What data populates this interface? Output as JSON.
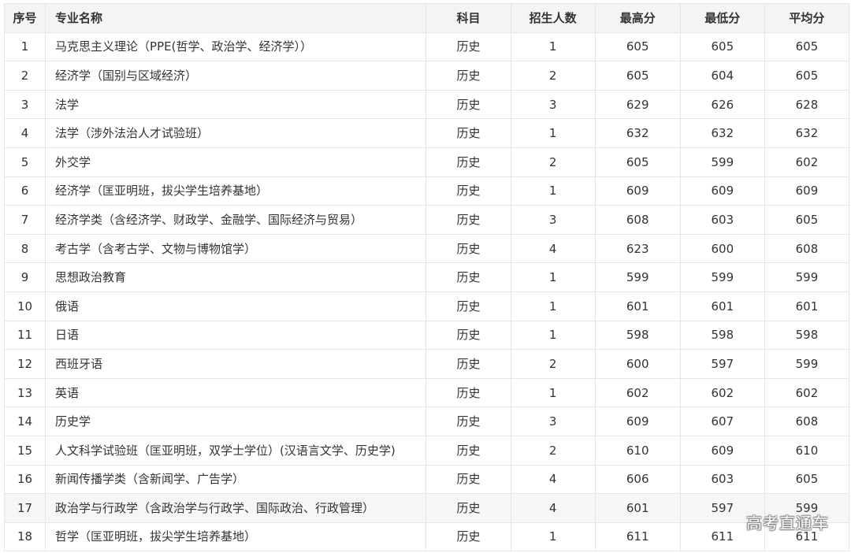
{
  "table": {
    "headers": [
      "序号",
      "专业名称",
      "科目",
      "招生人数",
      "最高分",
      "最低分",
      "平均分"
    ],
    "rows": [
      [
        "1",
        "马克思主义理论（PPE(哲学、政治学、经济学））",
        "历史",
        "1",
        "605",
        "605",
        "605"
      ],
      [
        "2",
        "经济学（国别与区域经济）",
        "历史",
        "2",
        "605",
        "604",
        "605"
      ],
      [
        "3",
        "法学",
        "历史",
        "3",
        "629",
        "626",
        "628"
      ],
      [
        "4",
        "法学（涉外法治人才试验班）",
        "历史",
        "1",
        "632",
        "632",
        "632"
      ],
      [
        "5",
        "外交学",
        "历史",
        "2",
        "605",
        "599",
        "602"
      ],
      [
        "6",
        "经济学（匡亚明班，拔尖学生培养基地）",
        "历史",
        "1",
        "609",
        "609",
        "609"
      ],
      [
        "7",
        "经济学类（含经济学、财政学、金融学、国际经济与贸易）",
        "历史",
        "3",
        "608",
        "603",
        "605"
      ],
      [
        "8",
        "考古学（含考古学、文物与博物馆学）",
        "历史",
        "4",
        "623",
        "600",
        "608"
      ],
      [
        "9",
        "思想政治教育",
        "历史",
        "1",
        "599",
        "599",
        "599"
      ],
      [
        "10",
        "俄语",
        "历史",
        "1",
        "601",
        "601",
        "601"
      ],
      [
        "11",
        "日语",
        "历史",
        "1",
        "598",
        "598",
        "598"
      ],
      [
        "12",
        "西班牙语",
        "历史",
        "2",
        "600",
        "597",
        "599"
      ],
      [
        "13",
        "英语",
        "历史",
        "1",
        "602",
        "602",
        "602"
      ],
      [
        "14",
        "历史学",
        "历史",
        "3",
        "609",
        "607",
        "608"
      ],
      [
        "15",
        "人文科学试验班（匡亚明班，双学士学位）(汉语言文学、历史学)",
        "历史",
        "2",
        "610",
        "609",
        "610"
      ],
      [
        "16",
        "新闻传播学类（含新闻学、广告学）",
        "历史",
        "4",
        "606",
        "603",
        "605"
      ],
      [
        "17",
        "政治学与行政学（含政治学与行政学、国际政治、行政管理）",
        "历史",
        "4",
        "601",
        "597",
        "599"
      ],
      [
        "18",
        "哲学（匡亚明班，拔尖学生培养基地）",
        "历史",
        "1",
        "611",
        "611",
        "611"
      ]
    ],
    "highlighted_row_index": 16
  },
  "watermark": "高考直通车",
  "colors": {
    "header_bg": "#f4f4f4",
    "border": "#e6e6e6",
    "text": "#333333",
    "highlight_bg": "#f6f6f6"
  }
}
